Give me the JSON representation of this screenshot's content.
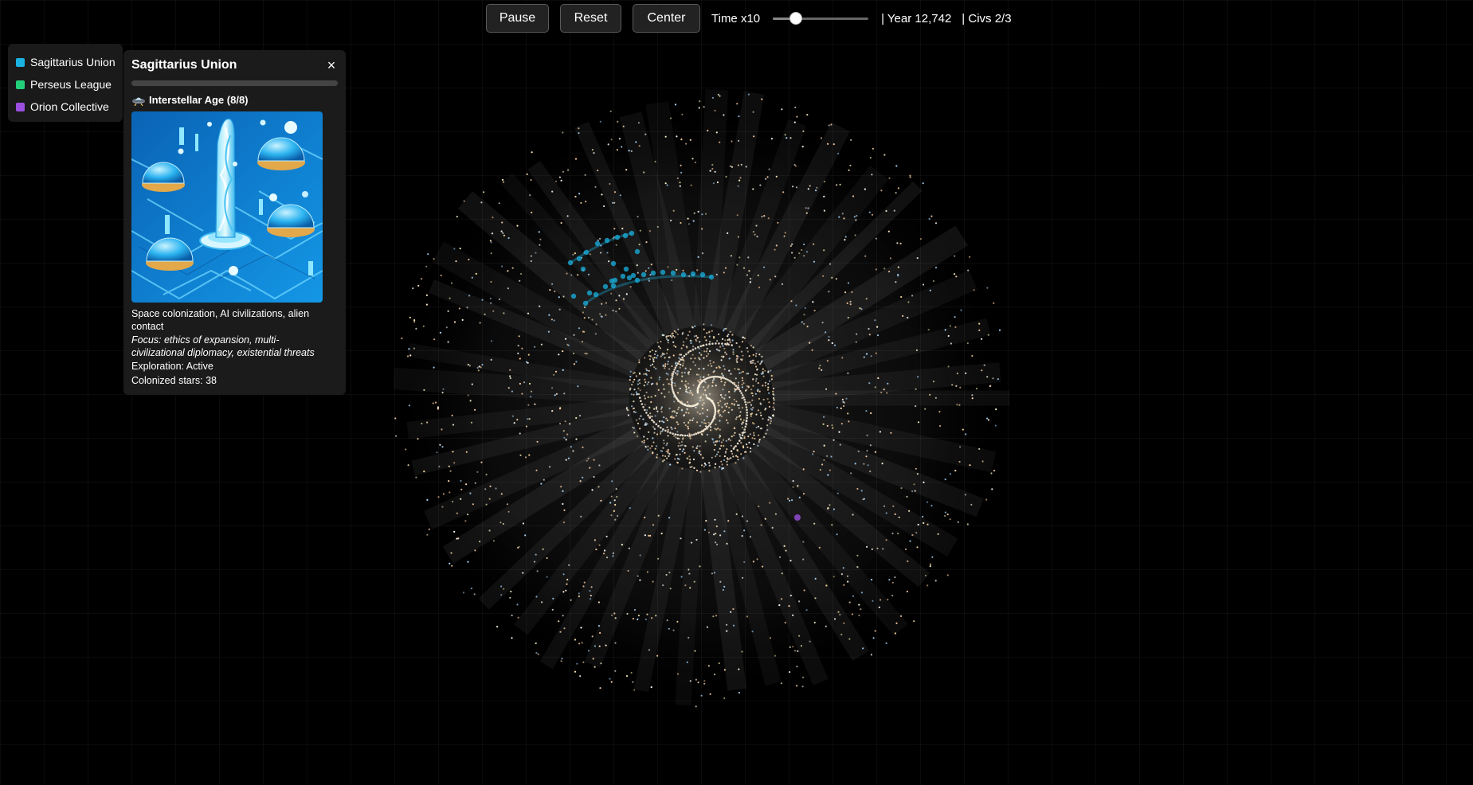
{
  "toolbar": {
    "pause_label": "Pause",
    "reset_label": "Reset",
    "center_label": "Center",
    "time_label": "Time x10",
    "speed_slider_value": 0.2,
    "year_label": "| Year 12,742",
    "civs_label": "| Civs 2/3"
  },
  "legend": {
    "items": [
      {
        "label": "Sagittarius Union",
        "color": "#1ab2e0"
      },
      {
        "label": "Perseus League",
        "color": "#22d07a"
      },
      {
        "label": "Orion Collective",
        "color": "#9b4fe0"
      }
    ]
  },
  "panel": {
    "title": "Sagittarius Union",
    "close_icon": "×",
    "progress": 0.0,
    "era_icon": "ufo-icon",
    "era_label": "Interstellar Age (8/8)",
    "image": "futuristic-city-illustration",
    "description": "Space colonization, AI civilizations, alien contact",
    "focus": "Focus: ethics of expansion, multi-civilizational diplomacy, existential threats",
    "exploration": "Exploration: Active",
    "colonized": "Colonized stars: 38"
  },
  "galaxy": {
    "civ_colors": {
      "sagittarius": "#1ab2e0",
      "orion": "#9b4fe0"
    }
  }
}
